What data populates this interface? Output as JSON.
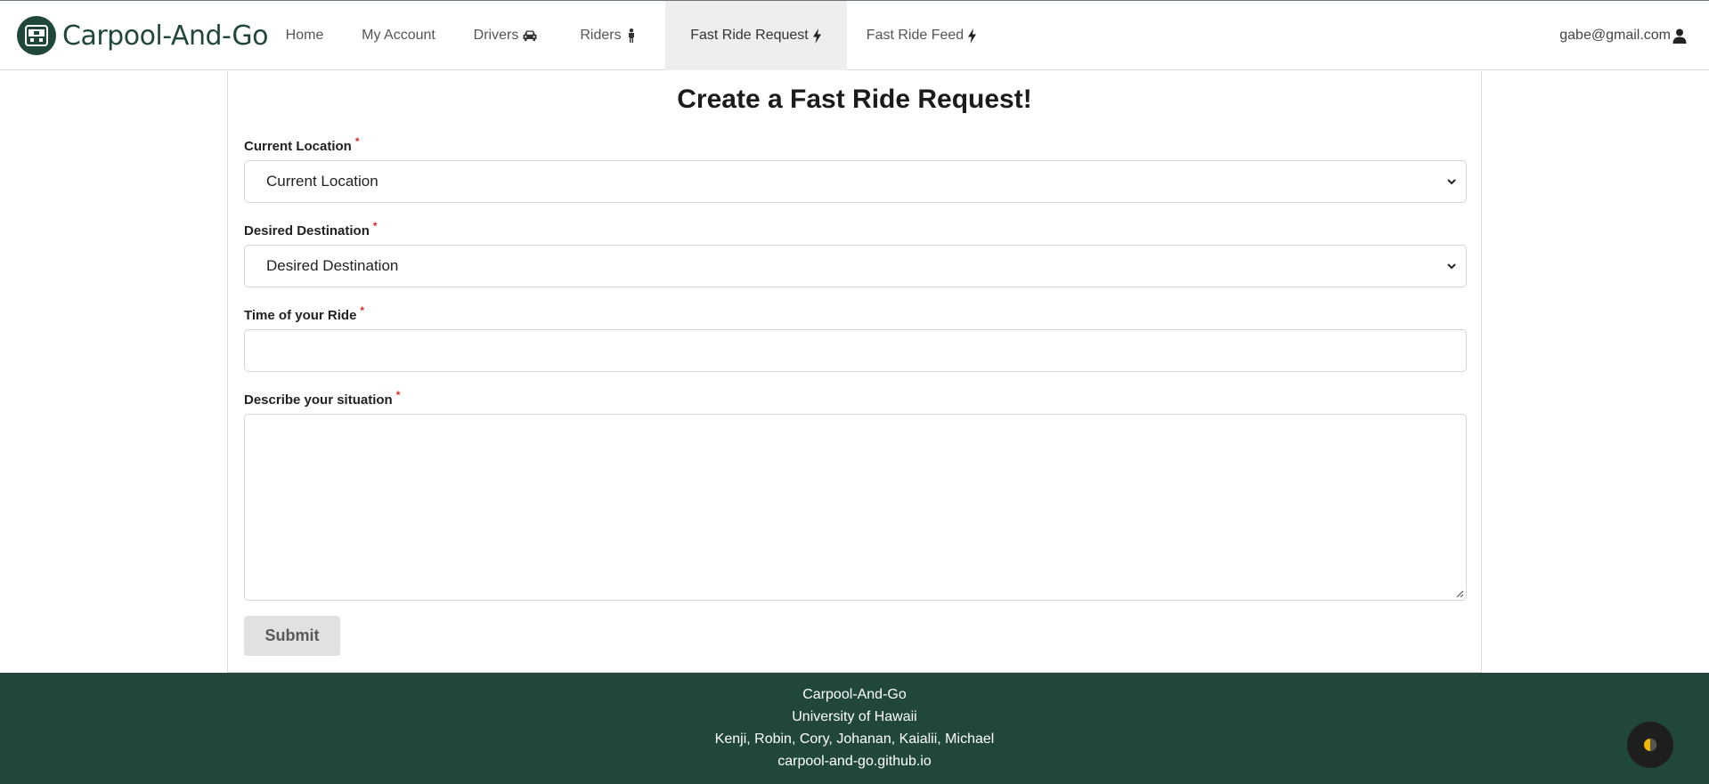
{
  "nav": {
    "brand": "Carpool-And-Go",
    "items": [
      {
        "label": "Home"
      },
      {
        "label": "My Account"
      },
      {
        "label": "Drivers",
        "icon": "car-icon"
      },
      {
        "label": "Riders",
        "icon": "person-icon"
      },
      {
        "label": "Fast Ride Request",
        "icon": "bolt-icon",
        "active": true
      },
      {
        "label": "Fast Ride Feed",
        "icon": "bolt-icon"
      }
    ],
    "user": "gabe@gmail.com",
    "user_icon": "user-icon"
  },
  "form": {
    "title": "Create a Fast Ride Request!",
    "current_location": {
      "label": "Current Location",
      "value": "Current Location"
    },
    "desired_destination": {
      "label": "Desired Destination",
      "value": "Desired Destination"
    },
    "time": {
      "label": "Time of your Ride",
      "value": ""
    },
    "situation": {
      "label": "Describe your situation",
      "value": ""
    },
    "required_mark": "*",
    "submit_label": "Submit"
  },
  "footer": {
    "lines": [
      "Carpool-And-Go",
      "University of Hawaii",
      "Kenji, Robin, Cory, Johanan, Kaialii, Michael",
      "carpool-and-go.github.io"
    ]
  },
  "colors": {
    "brand": "#21473a",
    "required": "#db2828",
    "active_nav_bg": "#eeeeee",
    "submit_bg": "#e0e1e2"
  }
}
